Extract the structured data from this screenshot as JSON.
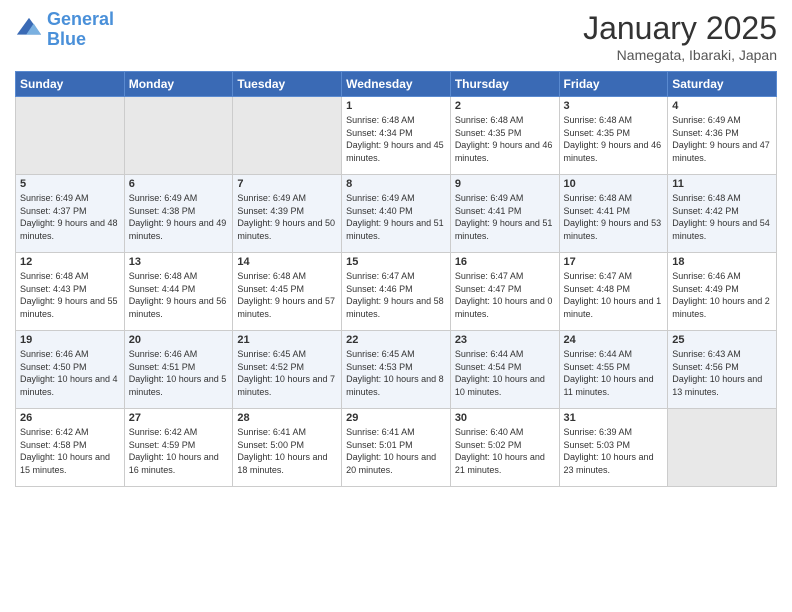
{
  "header": {
    "logo_line1": "General",
    "logo_line2": "Blue",
    "month": "January 2025",
    "location": "Namegata, Ibaraki, Japan"
  },
  "weekdays": [
    "Sunday",
    "Monday",
    "Tuesday",
    "Wednesday",
    "Thursday",
    "Friday",
    "Saturday"
  ],
  "weeks": [
    [
      {
        "day": "",
        "empty": true
      },
      {
        "day": "",
        "empty": true
      },
      {
        "day": "",
        "empty": true
      },
      {
        "day": "1",
        "sunrise": "6:48 AM",
        "sunset": "4:34 PM",
        "daylight": "9 hours and 45 minutes."
      },
      {
        "day": "2",
        "sunrise": "6:48 AM",
        "sunset": "4:35 PM",
        "daylight": "9 hours and 46 minutes."
      },
      {
        "day": "3",
        "sunrise": "6:48 AM",
        "sunset": "4:35 PM",
        "daylight": "9 hours and 46 minutes."
      },
      {
        "day": "4",
        "sunrise": "6:49 AM",
        "sunset": "4:36 PM",
        "daylight": "9 hours and 47 minutes."
      }
    ],
    [
      {
        "day": "5",
        "sunrise": "6:49 AM",
        "sunset": "4:37 PM",
        "daylight": "9 hours and 48 minutes."
      },
      {
        "day": "6",
        "sunrise": "6:49 AM",
        "sunset": "4:38 PM",
        "daylight": "9 hours and 49 minutes."
      },
      {
        "day": "7",
        "sunrise": "6:49 AM",
        "sunset": "4:39 PM",
        "daylight": "9 hours and 50 minutes."
      },
      {
        "day": "8",
        "sunrise": "6:49 AM",
        "sunset": "4:40 PM",
        "daylight": "9 hours and 51 minutes."
      },
      {
        "day": "9",
        "sunrise": "6:49 AM",
        "sunset": "4:41 PM",
        "daylight": "9 hours and 51 minutes."
      },
      {
        "day": "10",
        "sunrise": "6:48 AM",
        "sunset": "4:41 PM",
        "daylight": "9 hours and 53 minutes."
      },
      {
        "day": "11",
        "sunrise": "6:48 AM",
        "sunset": "4:42 PM",
        "daylight": "9 hours and 54 minutes."
      }
    ],
    [
      {
        "day": "12",
        "sunrise": "6:48 AM",
        "sunset": "4:43 PM",
        "daylight": "9 hours and 55 minutes."
      },
      {
        "day": "13",
        "sunrise": "6:48 AM",
        "sunset": "4:44 PM",
        "daylight": "9 hours and 56 minutes."
      },
      {
        "day": "14",
        "sunrise": "6:48 AM",
        "sunset": "4:45 PM",
        "daylight": "9 hours and 57 minutes."
      },
      {
        "day": "15",
        "sunrise": "6:47 AM",
        "sunset": "4:46 PM",
        "daylight": "9 hours and 58 minutes."
      },
      {
        "day": "16",
        "sunrise": "6:47 AM",
        "sunset": "4:47 PM",
        "daylight": "10 hours and 0 minutes."
      },
      {
        "day": "17",
        "sunrise": "6:47 AM",
        "sunset": "4:48 PM",
        "daylight": "10 hours and 1 minute."
      },
      {
        "day": "18",
        "sunrise": "6:46 AM",
        "sunset": "4:49 PM",
        "daylight": "10 hours and 2 minutes."
      }
    ],
    [
      {
        "day": "19",
        "sunrise": "6:46 AM",
        "sunset": "4:50 PM",
        "daylight": "10 hours and 4 minutes."
      },
      {
        "day": "20",
        "sunrise": "6:46 AM",
        "sunset": "4:51 PM",
        "daylight": "10 hours and 5 minutes."
      },
      {
        "day": "21",
        "sunrise": "6:45 AM",
        "sunset": "4:52 PM",
        "daylight": "10 hours and 7 minutes."
      },
      {
        "day": "22",
        "sunrise": "6:45 AM",
        "sunset": "4:53 PM",
        "daylight": "10 hours and 8 minutes."
      },
      {
        "day": "23",
        "sunrise": "6:44 AM",
        "sunset": "4:54 PM",
        "daylight": "10 hours and 10 minutes."
      },
      {
        "day": "24",
        "sunrise": "6:44 AM",
        "sunset": "4:55 PM",
        "daylight": "10 hours and 11 minutes."
      },
      {
        "day": "25",
        "sunrise": "6:43 AM",
        "sunset": "4:56 PM",
        "daylight": "10 hours and 13 minutes."
      }
    ],
    [
      {
        "day": "26",
        "sunrise": "6:42 AM",
        "sunset": "4:58 PM",
        "daylight": "10 hours and 15 minutes."
      },
      {
        "day": "27",
        "sunrise": "6:42 AM",
        "sunset": "4:59 PM",
        "daylight": "10 hours and 16 minutes."
      },
      {
        "day": "28",
        "sunrise": "6:41 AM",
        "sunset": "5:00 PM",
        "daylight": "10 hours and 18 minutes."
      },
      {
        "day": "29",
        "sunrise": "6:41 AM",
        "sunset": "5:01 PM",
        "daylight": "10 hours and 20 minutes."
      },
      {
        "day": "30",
        "sunrise": "6:40 AM",
        "sunset": "5:02 PM",
        "daylight": "10 hours and 21 minutes."
      },
      {
        "day": "31",
        "sunrise": "6:39 AM",
        "sunset": "5:03 PM",
        "daylight": "10 hours and 23 minutes."
      },
      {
        "day": "",
        "empty": true
      }
    ]
  ]
}
